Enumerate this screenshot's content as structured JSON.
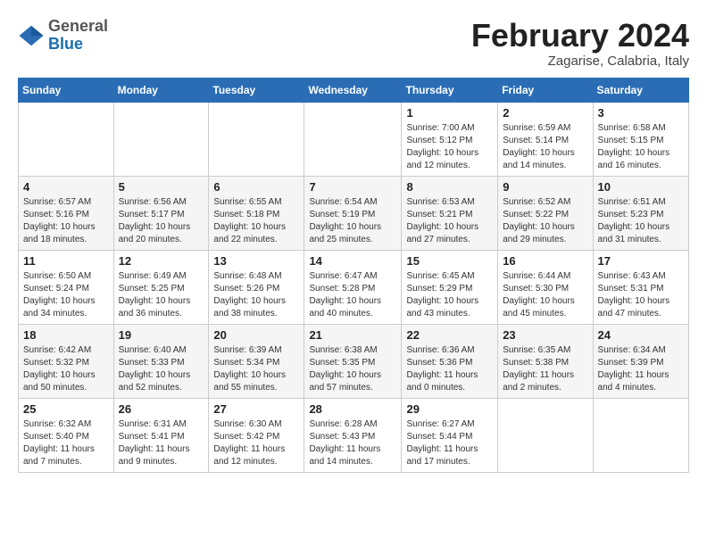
{
  "header": {
    "logo_general": "General",
    "logo_blue": "Blue",
    "month_year": "February 2024",
    "location": "Zagarise, Calabria, Italy"
  },
  "days_of_week": [
    "Sunday",
    "Monday",
    "Tuesday",
    "Wednesday",
    "Thursday",
    "Friday",
    "Saturday"
  ],
  "weeks": [
    [
      {
        "day": "",
        "info": ""
      },
      {
        "day": "",
        "info": ""
      },
      {
        "day": "",
        "info": ""
      },
      {
        "day": "",
        "info": ""
      },
      {
        "day": "1",
        "info": "Sunrise: 7:00 AM\nSunset: 5:12 PM\nDaylight: 10 hours\nand 12 minutes."
      },
      {
        "day": "2",
        "info": "Sunrise: 6:59 AM\nSunset: 5:14 PM\nDaylight: 10 hours\nand 14 minutes."
      },
      {
        "day": "3",
        "info": "Sunrise: 6:58 AM\nSunset: 5:15 PM\nDaylight: 10 hours\nand 16 minutes."
      }
    ],
    [
      {
        "day": "4",
        "info": "Sunrise: 6:57 AM\nSunset: 5:16 PM\nDaylight: 10 hours\nand 18 minutes."
      },
      {
        "day": "5",
        "info": "Sunrise: 6:56 AM\nSunset: 5:17 PM\nDaylight: 10 hours\nand 20 minutes."
      },
      {
        "day": "6",
        "info": "Sunrise: 6:55 AM\nSunset: 5:18 PM\nDaylight: 10 hours\nand 22 minutes."
      },
      {
        "day": "7",
        "info": "Sunrise: 6:54 AM\nSunset: 5:19 PM\nDaylight: 10 hours\nand 25 minutes."
      },
      {
        "day": "8",
        "info": "Sunrise: 6:53 AM\nSunset: 5:21 PM\nDaylight: 10 hours\nand 27 minutes."
      },
      {
        "day": "9",
        "info": "Sunrise: 6:52 AM\nSunset: 5:22 PM\nDaylight: 10 hours\nand 29 minutes."
      },
      {
        "day": "10",
        "info": "Sunrise: 6:51 AM\nSunset: 5:23 PM\nDaylight: 10 hours\nand 31 minutes."
      }
    ],
    [
      {
        "day": "11",
        "info": "Sunrise: 6:50 AM\nSunset: 5:24 PM\nDaylight: 10 hours\nand 34 minutes."
      },
      {
        "day": "12",
        "info": "Sunrise: 6:49 AM\nSunset: 5:25 PM\nDaylight: 10 hours\nand 36 minutes."
      },
      {
        "day": "13",
        "info": "Sunrise: 6:48 AM\nSunset: 5:26 PM\nDaylight: 10 hours\nand 38 minutes."
      },
      {
        "day": "14",
        "info": "Sunrise: 6:47 AM\nSunset: 5:28 PM\nDaylight: 10 hours\nand 40 minutes."
      },
      {
        "day": "15",
        "info": "Sunrise: 6:45 AM\nSunset: 5:29 PM\nDaylight: 10 hours\nand 43 minutes."
      },
      {
        "day": "16",
        "info": "Sunrise: 6:44 AM\nSunset: 5:30 PM\nDaylight: 10 hours\nand 45 minutes."
      },
      {
        "day": "17",
        "info": "Sunrise: 6:43 AM\nSunset: 5:31 PM\nDaylight: 10 hours\nand 47 minutes."
      }
    ],
    [
      {
        "day": "18",
        "info": "Sunrise: 6:42 AM\nSunset: 5:32 PM\nDaylight: 10 hours\nand 50 minutes."
      },
      {
        "day": "19",
        "info": "Sunrise: 6:40 AM\nSunset: 5:33 PM\nDaylight: 10 hours\nand 52 minutes."
      },
      {
        "day": "20",
        "info": "Sunrise: 6:39 AM\nSunset: 5:34 PM\nDaylight: 10 hours\nand 55 minutes."
      },
      {
        "day": "21",
        "info": "Sunrise: 6:38 AM\nSunset: 5:35 PM\nDaylight: 10 hours\nand 57 minutes."
      },
      {
        "day": "22",
        "info": "Sunrise: 6:36 AM\nSunset: 5:36 PM\nDaylight: 11 hours\nand 0 minutes."
      },
      {
        "day": "23",
        "info": "Sunrise: 6:35 AM\nSunset: 5:38 PM\nDaylight: 11 hours\nand 2 minutes."
      },
      {
        "day": "24",
        "info": "Sunrise: 6:34 AM\nSunset: 5:39 PM\nDaylight: 11 hours\nand 4 minutes."
      }
    ],
    [
      {
        "day": "25",
        "info": "Sunrise: 6:32 AM\nSunset: 5:40 PM\nDaylight: 11 hours\nand 7 minutes."
      },
      {
        "day": "26",
        "info": "Sunrise: 6:31 AM\nSunset: 5:41 PM\nDaylight: 11 hours\nand 9 minutes."
      },
      {
        "day": "27",
        "info": "Sunrise: 6:30 AM\nSunset: 5:42 PM\nDaylight: 11 hours\nand 12 minutes."
      },
      {
        "day": "28",
        "info": "Sunrise: 6:28 AM\nSunset: 5:43 PM\nDaylight: 11 hours\nand 14 minutes."
      },
      {
        "day": "29",
        "info": "Sunrise: 6:27 AM\nSunset: 5:44 PM\nDaylight: 11 hours\nand 17 minutes."
      },
      {
        "day": "",
        "info": ""
      },
      {
        "day": "",
        "info": ""
      }
    ]
  ]
}
